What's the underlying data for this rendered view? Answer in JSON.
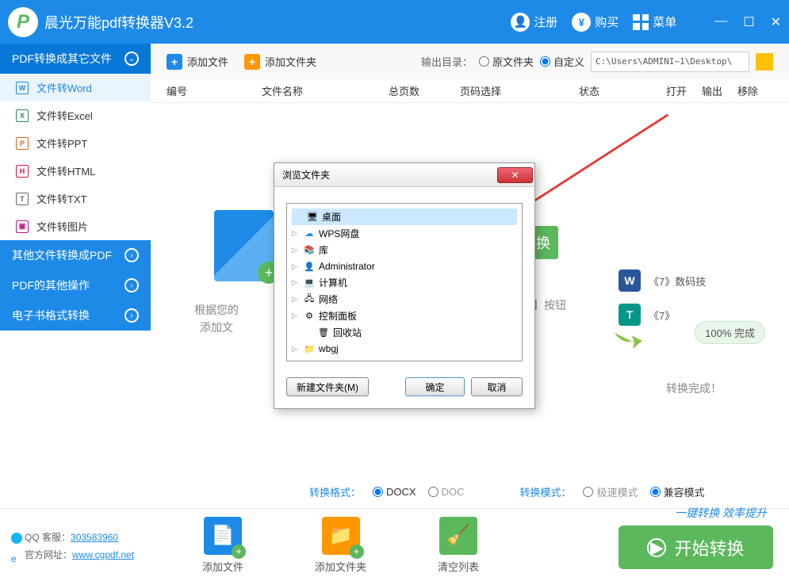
{
  "header": {
    "title": "晨光万能pdf转换器V3.2",
    "register": "注册",
    "buy": "购买",
    "menu": "菜单"
  },
  "sidebar": {
    "cat1": "PDF转换成其它文件",
    "items": [
      {
        "label": "文件转Word",
        "letter": "W"
      },
      {
        "label": "文件转Excel",
        "letter": "X"
      },
      {
        "label": "文件转PPT",
        "letter": "P"
      },
      {
        "label": "文件转HTML",
        "letter": "H"
      },
      {
        "label": "文件转TXT",
        "letter": "T"
      },
      {
        "label": "文件转图片",
        "letter": "▣"
      }
    ],
    "cat2": "其他文件转换成PDF",
    "cat3": "PDF的其他操作",
    "cat4": "电子书格式转换"
  },
  "toolbar": {
    "add_file": "添加文件",
    "add_folder": "添加文件夹",
    "output_dir": "输出目录：",
    "orig_folder": "原文件夹",
    "custom": "自定义",
    "path": "C:\\Users\\ADMINI~1\\Desktop\\"
  },
  "columns": {
    "c1": "编号",
    "c2": "文件名称",
    "c3": "总页数",
    "c4": "页码选择",
    "c5": "状态",
    "c6": "打开",
    "c7": "输出",
    "c8": "移除"
  },
  "illus": {
    "hint1": "根据您的",
    "hint2": "添加文",
    "start_pill": "始转换",
    "btn_hint": "始转换】按钮",
    "result1": "《7》数码技",
    "result2": "《7》",
    "progress": "100%  完成",
    "done": "转换完成！"
  },
  "fmt_bar": {
    "fmt_label": "转换格式：",
    "docx": "DOCX",
    "doc": "DOC",
    "mode_label": "转换模式：",
    "fast": "极速模式",
    "compat": "兼容模式"
  },
  "footer": {
    "qq_label": "QQ 客服：",
    "qq_num": "303583960",
    "site_label": "官方网址：",
    "site_url": "www.cgpdf.net",
    "add_file": "添加文件",
    "add_folder": "添加文件夹",
    "clear": "清空列表",
    "slogan": "一键转换  效率提升",
    "start": "开始转换"
  },
  "dialog": {
    "title": "浏览文件夹",
    "tree": [
      {
        "label": "桌面",
        "sel": true,
        "tri": ""
      },
      {
        "label": "WPS网盘",
        "tri": "▷"
      },
      {
        "label": "库",
        "tri": "▷"
      },
      {
        "label": "Administrator",
        "tri": "▷"
      },
      {
        "label": "计算机",
        "tri": "▷"
      },
      {
        "label": "网络",
        "tri": "▷"
      },
      {
        "label": "控制面板",
        "tri": "▷"
      },
      {
        "label": "回收站",
        "tri": ""
      },
      {
        "label": "wbgj",
        "tri": "▷"
      }
    ],
    "new_folder": "新建文件夹(M)",
    "ok": "确定",
    "cancel": "取消"
  }
}
